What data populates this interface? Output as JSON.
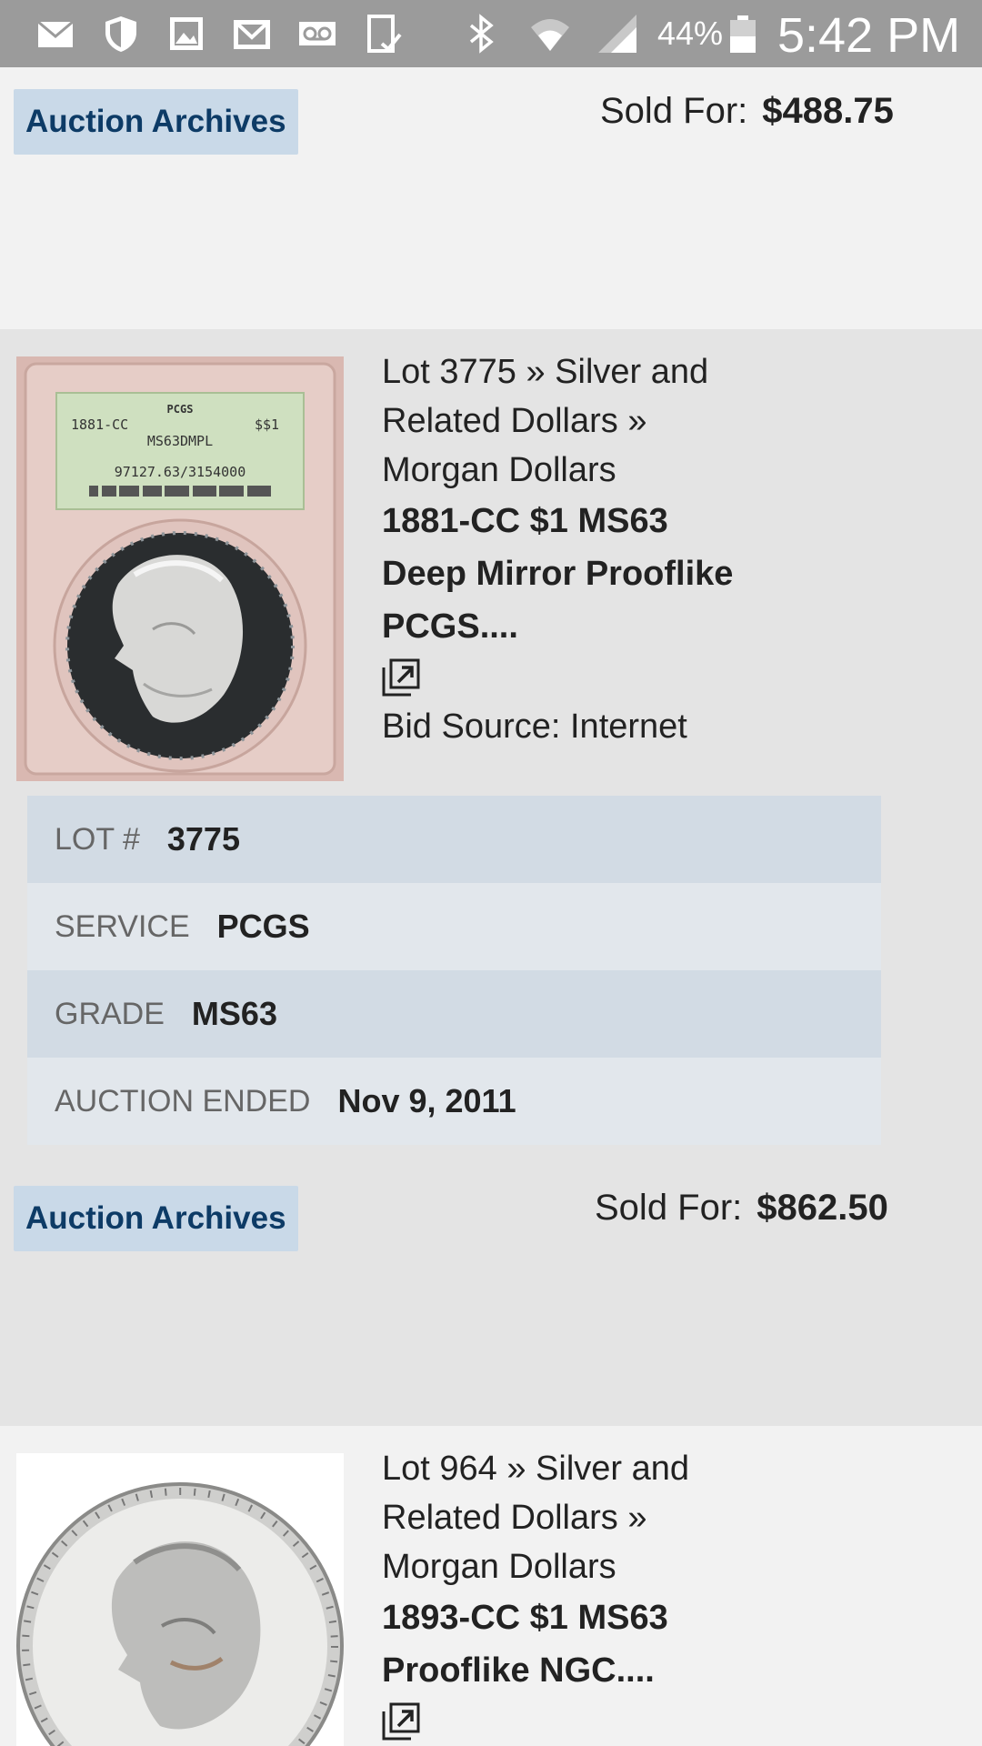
{
  "status_bar": {
    "icons": [
      "mail-icon",
      "shield-icon",
      "image-icon",
      "gmail-icon",
      "voicemail-icon",
      "device-icon",
      "bluetooth-icon",
      "wifi-icon",
      "signal-icon",
      "battery-icon"
    ],
    "battery": "44%",
    "time": "5:42 PM"
  },
  "listings": [
    {
      "archive_label": "Auction Archives",
      "sold_label": "Sold For:",
      "sold_value": "$488.75"
    },
    {
      "category": "Lot 3775 » Silver and Related Dollars » Morgan Dollars",
      "title": "1881-CC $1 MS63 Deep Mirror Prooflike PCGS....",
      "bid_source": "Bid Source: Internet",
      "thumbnail_slab_text": [
        "PCGS",
        "1881-CC",
        "$$1",
        "MS63DMPL",
        "97127.63/3154000"
      ],
      "details": [
        {
          "label": "LOT #",
          "value": "3775"
        },
        {
          "label": "SERVICE",
          "value": "PCGS"
        },
        {
          "label": "GRADE",
          "value": "MS63"
        },
        {
          "label": "AUCTION ENDED",
          "value": "Nov 9, 2011"
        }
      ],
      "archive_label": "Auction Archives",
      "sold_label": "Sold For:",
      "sold_value": "$862.50"
    },
    {
      "category": "Lot 964 » Silver and Related Dollars » Morgan Dollars",
      "title": "1893-CC $1 MS63 Prooflike NGC...."
    }
  ]
}
